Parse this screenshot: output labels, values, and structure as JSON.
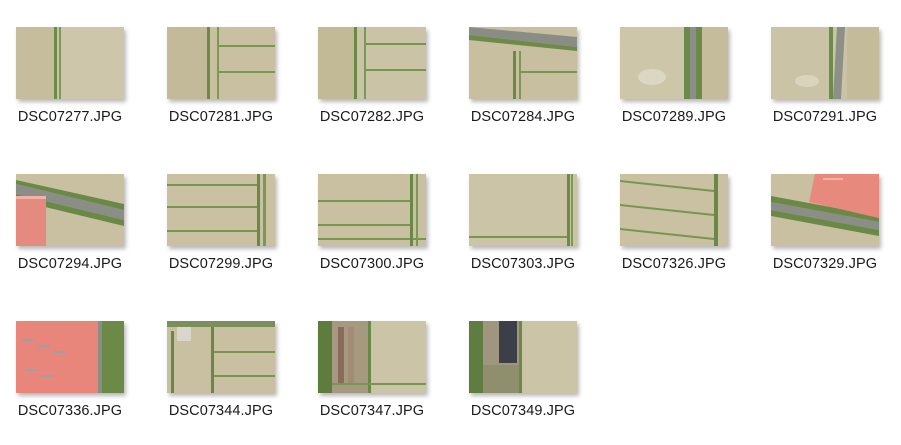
{
  "files": [
    {
      "name": "DSC07277.JPG",
      "scene": "field-vertical-strips"
    },
    {
      "name": "DSC07281.JPG",
      "scene": "field-vertical-plus-horizontal"
    },
    {
      "name": "DSC07282.JPG",
      "scene": "field-vertical-plus-horizontal"
    },
    {
      "name": "DSC07284.JPG",
      "scene": "field-road-top"
    },
    {
      "name": "DSC07289.JPG",
      "scene": "field-road-right"
    },
    {
      "name": "DSC07291.JPG",
      "scene": "field-road-right"
    },
    {
      "name": "DSC07294.JPG",
      "scene": "field-road-diagonal-red-roof"
    },
    {
      "name": "DSC07299.JPG",
      "scene": "field-horizontal-strips"
    },
    {
      "name": "DSC07300.JPG",
      "scene": "field-horizontal-strips"
    },
    {
      "name": "DSC07303.JPG",
      "scene": "field-plain"
    },
    {
      "name": "DSC07326.JPG",
      "scene": "field-horizontal-strips"
    },
    {
      "name": "DSC07329.JPG",
      "scene": "field-road-red-roof-right"
    },
    {
      "name": "DSC07336.JPG",
      "scene": "red-roof-building"
    },
    {
      "name": "DSC07344.JPG",
      "scene": "field-vertical-plus-horizontal"
    },
    {
      "name": "DSC07347.JPG",
      "scene": "field-left-structures"
    },
    {
      "name": "DSC07349.JPG",
      "scene": "field-dark-building-left"
    }
  ]
}
